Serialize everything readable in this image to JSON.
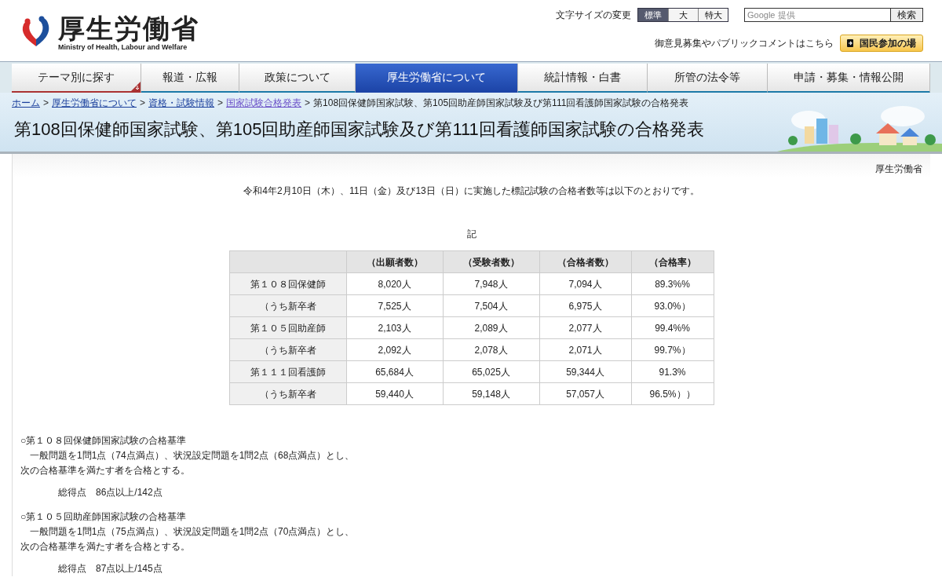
{
  "logo": {
    "name": "厚生労働省",
    "subtitle": "Ministry of Health, Labour and Welfare"
  },
  "font_size": {
    "label": "文字サイズの変更",
    "options": [
      {
        "label": "標準",
        "selected": true
      },
      {
        "label": "大",
        "selected": false
      },
      {
        "label": "特大",
        "selected": false
      }
    ]
  },
  "search": {
    "placeholder": "Google 提供",
    "button": "検索"
  },
  "participation": {
    "text": "御意見募集やパブリックコメントはこちら",
    "button": "国民参加の場"
  },
  "nav": [
    {
      "label": "テーマ別に探す",
      "kind": "menu",
      "selected": false
    },
    {
      "label": "報道・広報",
      "kind": "link",
      "selected": false
    },
    {
      "label": "政策について",
      "kind": "link",
      "selected": false
    },
    {
      "label": "厚生労働省について",
      "kind": "link",
      "selected": true
    },
    {
      "label": "統計情報・白書",
      "kind": "link",
      "selected": false
    },
    {
      "label": "所管の法令等",
      "kind": "link",
      "selected": false
    },
    {
      "label": "申請・募集・情報公開",
      "kind": "link",
      "selected": false
    }
  ],
  "breadcrumb": [
    {
      "label": "ホーム",
      "visited": false,
      "separator": ">"
    },
    {
      "label": "厚生労働省について",
      "visited": false,
      "separator": ">"
    },
    {
      "label": "資格・試験情報",
      "visited": false,
      "separator": ">"
    },
    {
      "label": "国家試験合格発表",
      "visited": true,
      "separator": ">"
    }
  ],
  "breadcrumb_current": "第108回保健師国家試験、第105回助産師国家試験及び第111回看護師国家試験の合格発表",
  "page_title": "第108回保健師国家試験、第105回助産師国家試験及び第111回看護師国家試験の合格発表",
  "author": "厚生労働省",
  "intro": "令和4年2月10日（木）、11日（金）及び13日（日）に実施した標記試験の合格者数等は以下のとおりです。",
  "table_caption": "記",
  "table": {
    "columns": [
      "",
      "（出願者数）",
      "（受験者数）",
      "（合格者数）",
      "（合格率）"
    ],
    "rows": [
      [
        "第１０８回保健師",
        "8,020人",
        "7,948人",
        "7,094人",
        "89.3%%"
      ],
      [
        "（うち新卒者",
        "7,525人",
        "7,504人",
        "6,975人",
        "93.0%）"
      ],
      [
        "第１０５回助産師",
        "2,103人",
        "2,089人",
        "2,077人",
        "99.4%%"
      ],
      [
        "（うち新卒者",
        "2,092人",
        "2,078人",
        "2,071人",
        "99.7%）"
      ],
      [
        "第１１１回看護師",
        "65,684人",
        "65,025人",
        "59,344人",
        "91.3%"
      ],
      [
        "（うち新卒者",
        "59,440人",
        "59,148人",
        "57,057人",
        "96.5%））"
      ]
    ]
  },
  "criteria": [
    {
      "heading": "○第１０８回保健師国家試験の合格基準",
      "lines": [
        "　一般問題を1問1点（74点満点）、状況設定問題を1問2点（68点満点）とし、",
        "次の合格基準を満たす者を合格とする。"
      ],
      "score": "総得点　86点以上/142点"
    },
    {
      "heading": "○第１０５回助産師国家試験の合格基準",
      "lines": [
        "　一般問題を1問1点（75点満点）、状況設定問題を1問2点（70点満点）とし、",
        "次の合格基準を満たす者を合格とする。"
      ],
      "score": "総得点　87点以上/145点"
    }
  ]
}
